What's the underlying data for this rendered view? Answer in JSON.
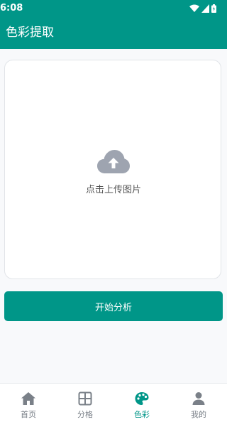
{
  "statusbar": {
    "time": "6:08"
  },
  "header": {
    "title": "色彩提取"
  },
  "upload": {
    "label": "点击上传图片"
  },
  "analyze": {
    "label": "开始分析"
  },
  "nav": {
    "items": [
      {
        "label": "首页",
        "icon": "home-icon",
        "active": false
      },
      {
        "label": "分格",
        "icon": "grid-icon",
        "active": false
      },
      {
        "label": "色彩",
        "icon": "palette-icon",
        "active": true
      },
      {
        "label": "我的",
        "icon": "person-icon",
        "active": false
      }
    ]
  },
  "colors": {
    "primary": "#009688",
    "inactive": "#7a8088",
    "cloud": "#9ea4b0"
  }
}
